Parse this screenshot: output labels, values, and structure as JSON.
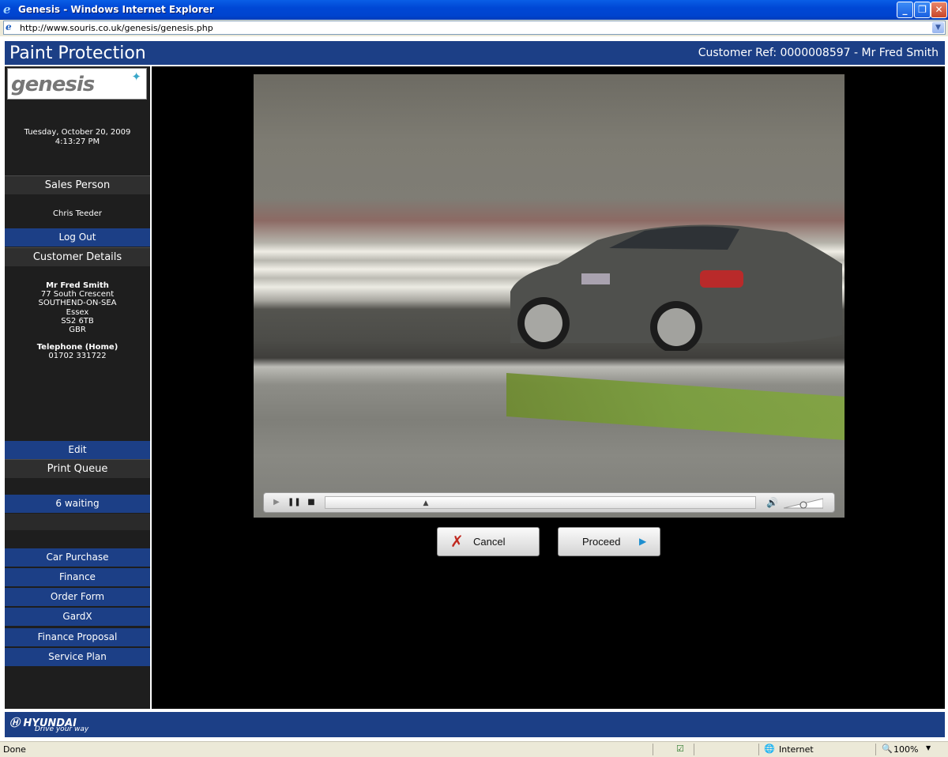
{
  "window": {
    "title": "Genesis - Windows Internet Explorer",
    "address_url": "http://www.souris.co.uk/genesis/genesis.php",
    "status_text": "Done",
    "zone_label": "Internet",
    "zoom_label": "100%"
  },
  "header": {
    "app_title": "Paint Protection",
    "customer_ref": "Customer Ref: 0000008597 - Mr Fred Smith"
  },
  "sidebar": {
    "logo_text": "genesis",
    "date": "Tuesday, October 20, 2009",
    "time": "4:13:27 PM",
    "sales_person_heading": "Sales Person",
    "sales_person_name": "Chris Teeder",
    "logout_label": "Log Out",
    "customer_details_heading": "Customer Details",
    "customer": {
      "name": "Mr Fred Smith",
      "address_lines": [
        "77 South Crescent",
        "SOUTHEND-ON-SEA",
        "Essex",
        "SS2 6TB",
        "GBR"
      ],
      "phone_heading": "Telephone (Home)",
      "phone": "01702 331722"
    },
    "edit_label": "Edit",
    "print_queue_heading": "Print Queue",
    "print_queue_status": "6 waiting",
    "nav_items": [
      "Car Purchase",
      "Finance",
      "Order Form",
      "GardX",
      "Finance Proposal",
      "Service Plan"
    ]
  },
  "video": {
    "seek_fraction": 0.23,
    "volume_fraction": 0.5
  },
  "actions": {
    "cancel_label": "Cancel",
    "proceed_label": "Proceed"
  },
  "footer": {
    "brand": "HYUNDAI",
    "tagline": "Drive your way"
  }
}
